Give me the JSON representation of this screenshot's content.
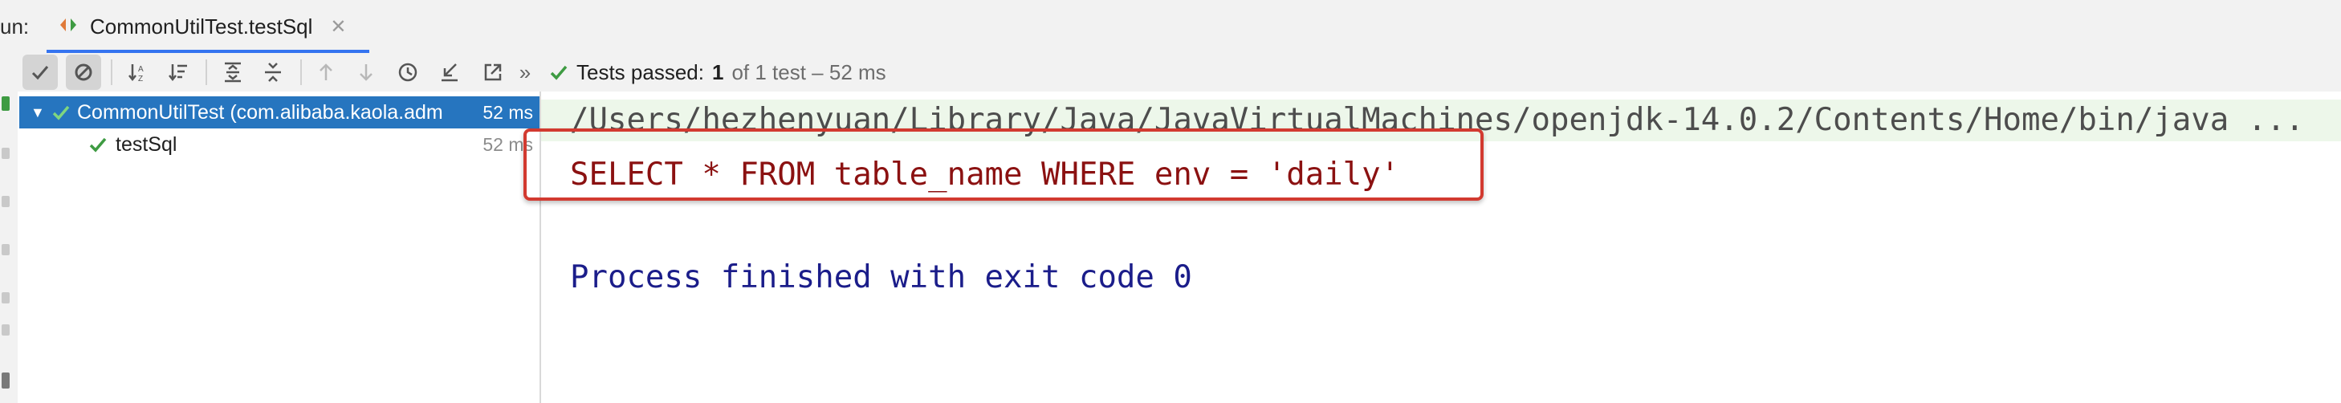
{
  "run_panel": {
    "label": "un:",
    "tab": {
      "title": "CommonUtilTest.testSql",
      "icon": "test-run-icon",
      "close_icon": "close-icon"
    }
  },
  "toolbar": {
    "buttons": [
      {
        "name": "show-passed-toggle",
        "icon": "check-icon",
        "active": true
      },
      {
        "name": "show-ignored-toggle",
        "icon": "ignored-icon",
        "active": true
      },
      {
        "name": "sort-alphabetically-button",
        "icon": "sort-alpha-icon"
      },
      {
        "name": "sort-by-duration-button",
        "icon": "sort-duration-icon"
      },
      {
        "name": "expand-all-button",
        "icon": "expand-all-icon"
      },
      {
        "name": "collapse-all-button",
        "icon": "collapse-all-icon"
      },
      {
        "name": "previous-failed-button",
        "icon": "arrow-up-icon"
      },
      {
        "name": "next-failed-button",
        "icon": "arrow-down-icon"
      },
      {
        "name": "test-history-button",
        "icon": "history-icon"
      },
      {
        "name": "import-tests-button",
        "icon": "import-icon"
      },
      {
        "name": "export-tests-button",
        "icon": "export-icon"
      },
      {
        "name": "more-button",
        "icon": "chevron-double-right-icon"
      }
    ],
    "status": {
      "label": "Tests passed:",
      "count": "1",
      "rest": "of 1 test – 52 ms"
    }
  },
  "tree": {
    "items": [
      {
        "name": "CommonUtilTest (com.alibaba.kaola.adm",
        "time": "52 ms",
        "status": "passed",
        "expanded": true,
        "selected": true
      },
      {
        "name": "testSql",
        "time": "52 ms",
        "status": "passed"
      }
    ]
  },
  "console": {
    "command": "/Users/hezhenyuan/Library/Java/JavaVirtualMachines/openjdk-14.0.2/Contents/Home/bin/java ...",
    "output": "SELECT * FROM table_name WHERE env = 'daily'",
    "exit": "Process finished with exit code 0"
  },
  "colors": {
    "accent": "#3574f0",
    "selection": "#2675bf",
    "passed": "#3e9b42",
    "output_text": "#8b1111",
    "exit_text": "#1b1d8a",
    "highlight": "#d23a30"
  }
}
